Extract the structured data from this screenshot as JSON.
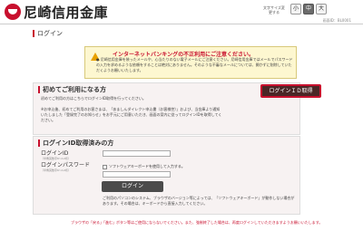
{
  "header": {
    "bank_name": "尼崎信用金庫",
    "font_size_label": "文字サイズ変更する",
    "font_size_options": [
      "小",
      "中",
      "大"
    ],
    "page_id": "画面ID：BL0001"
  },
  "page": {
    "title": "ログイン"
  },
  "notice": {
    "title": "インターネットバンキングの不正利用にご注意ください。",
    "body": "● 尼崎信用金庫を装ったメールや、心当たりのない電子メールにご注意ください。尼崎信用金庫ではメールでパスワードの入力を求めるような依頼をすることは絶対にありません。そのような不審なメールについては、開かずに削除していただくようお願いいたします。"
  },
  "first_time": {
    "title": "初めてご利用になる方",
    "desc": "初めてご利用の方はこちらでログインID取得を行ってください。",
    "note": "※お申込後、初めてご利用のお客さまは、「あましんダイレクト申込書（お客様控）」および、当金庫より通知いたしました「登録完了のお知らせ」をお手元にご用意いただき、画面の案内に従ってログインIDを取得してください。",
    "button": "ログインＩＤ取得"
  },
  "acquired": {
    "title": "ログインID取得済みの方",
    "login_id_label": "ログインID",
    "login_id_sub": "（半角英数字6〜12桁）",
    "password_label": "ログインパスワード",
    "password_sub": "（半角英数字6〜12桁）",
    "software_keyboard_label": "ソフトウェアキーボードを使用して入力する。",
    "login_button": "ログイン",
    "env_note": "ご利用のパソコンのシステム、ブラウザのバージョン等によっては、「ソフトウェアキーボード」が動作しない場合があります。その場合は、キーボードから直接入力してください。"
  },
  "footer": {
    "note": "ブラウザの「戻る」「進む」ボタン等はご使用にならないでください。また、強制終了した場合は、再度ログインしていただきますようお願いいたします。"
  },
  "colors": {
    "brand": "#c8102e",
    "notice_bg": "#fdf7d0",
    "panel_bg": "#f7f2f2"
  }
}
